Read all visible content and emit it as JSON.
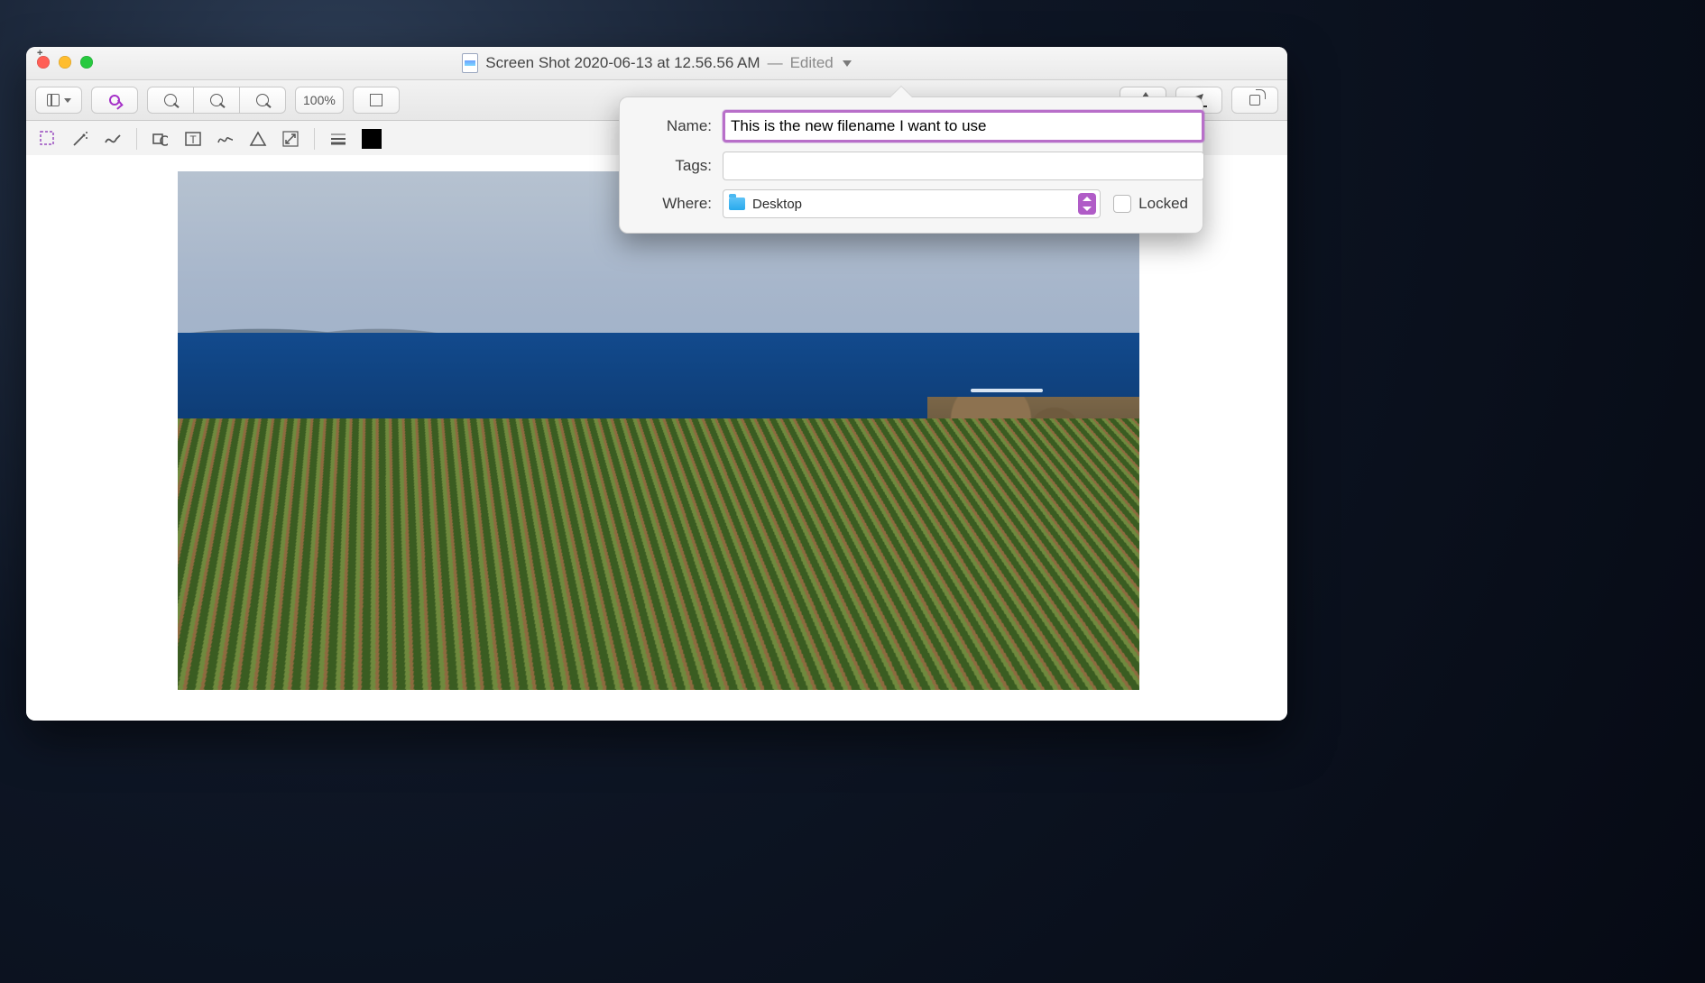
{
  "window": {
    "title_main": "Screen Shot 2020-06-13 at 12.56.56 AM",
    "title_sep": " — ",
    "title_status": "Edited"
  },
  "toolbar": {
    "zoom_label": "100%"
  },
  "popover": {
    "name_label": "Name:",
    "name_value": "This is the new filename I want to use",
    "tags_label": "Tags:",
    "tags_value": "",
    "where_label": "Where:",
    "where_value": "Desktop",
    "locked_label": "Locked",
    "locked_checked": false
  }
}
